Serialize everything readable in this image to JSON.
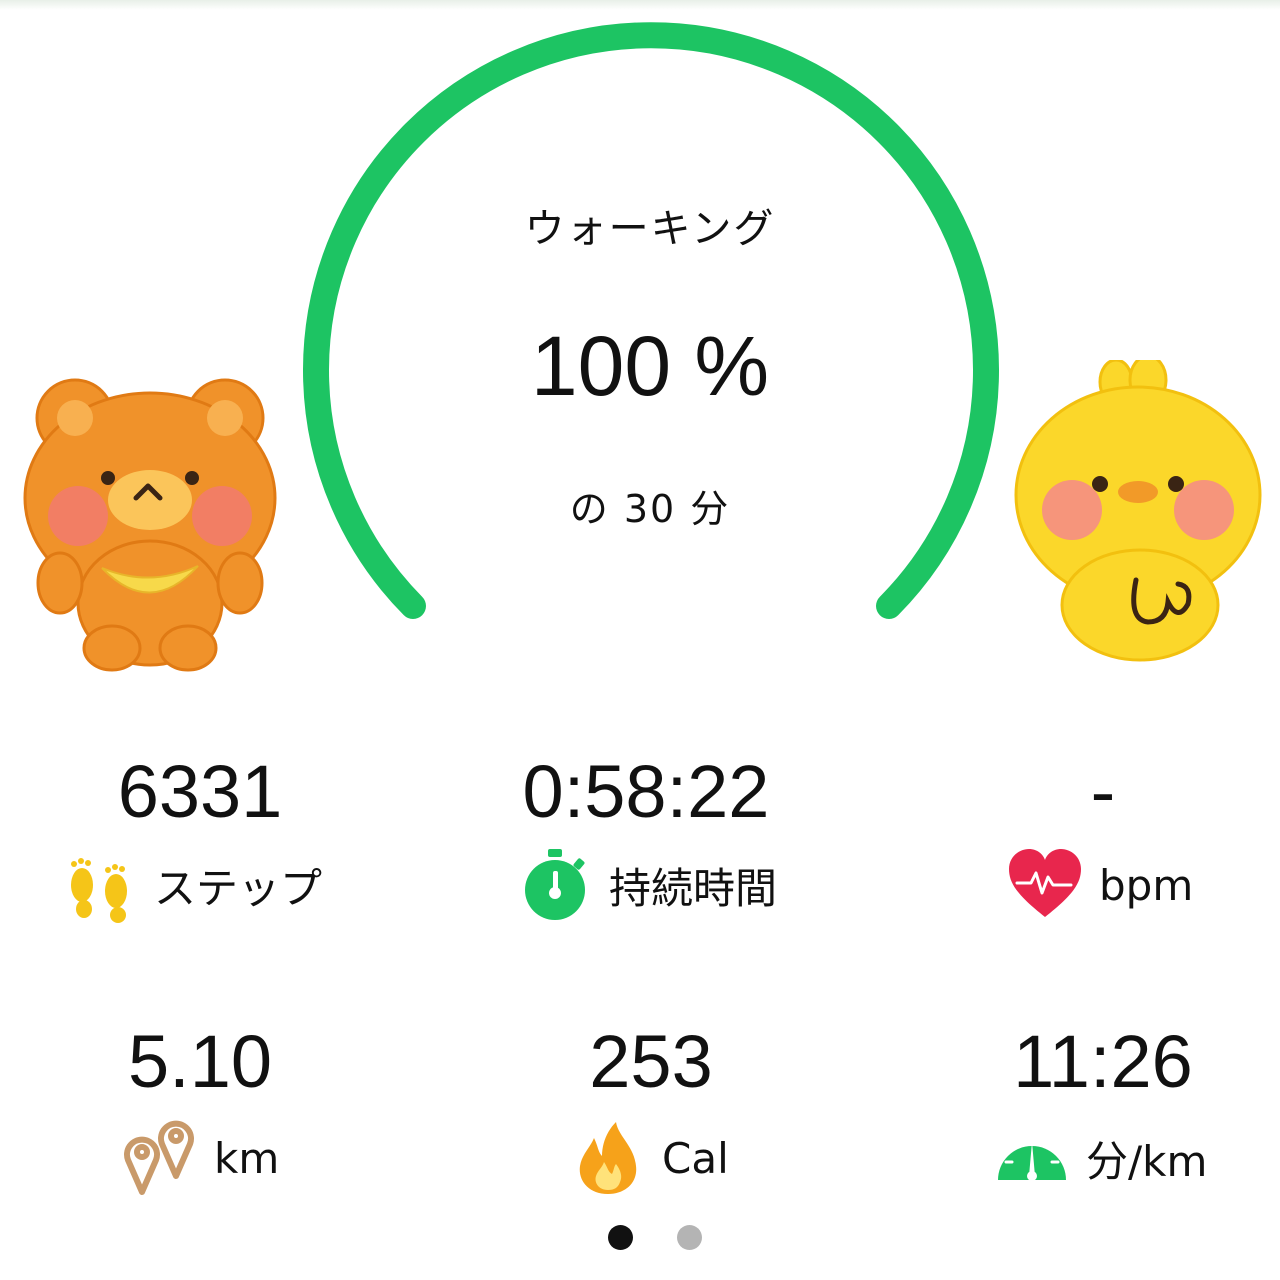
{
  "colors": {
    "ring": "#1dc463",
    "stopwatch": "#1dc463",
    "heart": "#e8264d",
    "footprint": "#f5c518",
    "location": "#c99a6a",
    "flame": "#f6a21a",
    "speedometer": "#1dc463"
  },
  "goal": {
    "activity": "ウォーキング",
    "progress_text": "100 %",
    "progress": 1.0,
    "target": "の 30 分"
  },
  "stats": [
    {
      "value": "6331",
      "unit": "ステップ",
      "icon": "footprint-icon"
    },
    {
      "value": "0:58:22",
      "unit": "持続時間",
      "icon": "stopwatch-icon"
    },
    {
      "value": "-",
      "unit": "bpm",
      "icon": "heart-icon"
    },
    {
      "value": "5.10",
      "unit": "km",
      "icon": "location-pin-icon"
    },
    {
      "value": "253",
      "unit": "Cal",
      "icon": "flame-icon"
    },
    {
      "value": "11:26",
      "unit": "分/km",
      "icon": "speedometer-icon"
    }
  ],
  "pager": {
    "pages": 2,
    "current": 1
  }
}
